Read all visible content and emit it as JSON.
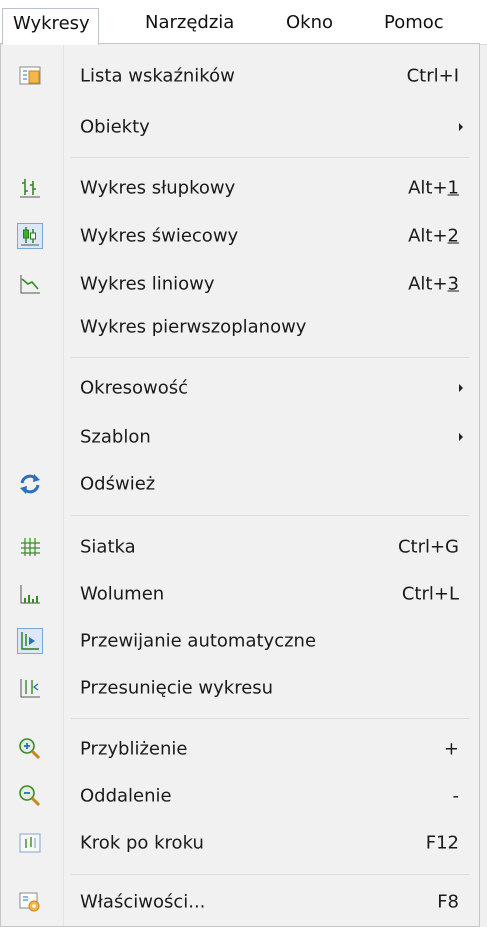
{
  "menubar": {
    "items": [
      "Wykresy",
      "Narzędzia",
      "Okno",
      "Pomoc"
    ]
  },
  "menu": {
    "items": [
      {
        "label": "Lista wskaźników",
        "shortcut": "Ctrl+I",
        "icon": "indicator-list-icon"
      },
      {
        "label": "Obiekty",
        "submenu": true
      },
      {
        "label": "Wykres słupkowy",
        "shortcut": "Alt+1",
        "icon": "bar-chart-icon"
      },
      {
        "label": "Wykres świecowy",
        "shortcut": "Alt+2",
        "icon": "candlestick-chart-icon",
        "checked": true
      },
      {
        "label": "Wykres liniowy",
        "shortcut": "Alt+3",
        "icon": "line-chart-icon"
      },
      {
        "label": "Wykres pierwszoplanowy"
      },
      {
        "label": "Okresowość",
        "submenu": true
      },
      {
        "label": "Szablon",
        "submenu": true
      },
      {
        "label": "Odśwież",
        "icon": "refresh-icon"
      },
      {
        "label": "Siatka",
        "shortcut": "Ctrl+G",
        "icon": "grid-icon"
      },
      {
        "label": "Wolumen",
        "shortcut": "Ctrl+L",
        "icon": "volume-icon"
      },
      {
        "label": "Przewijanie automatyczne",
        "icon": "auto-scroll-icon",
        "checked": true
      },
      {
        "label": "Przesunięcie wykresu",
        "icon": "chart-shift-icon"
      },
      {
        "label": "Przybliżenie",
        "shortcut": "+",
        "icon": "zoom-in-icon"
      },
      {
        "label": "Oddalenie",
        "shortcut": "-",
        "icon": "zoom-out-icon"
      },
      {
        "label": "Krok po kroku",
        "shortcut": "F12",
        "icon": "step-by-step-icon"
      },
      {
        "label": "Właściwości...",
        "shortcut": "F8",
        "icon": "properties-icon"
      }
    ]
  },
  "colors": {
    "accent_blue": "#2c6fbf",
    "icon_green": "#3a8a2a",
    "icon_orange": "#e8a33a"
  }
}
